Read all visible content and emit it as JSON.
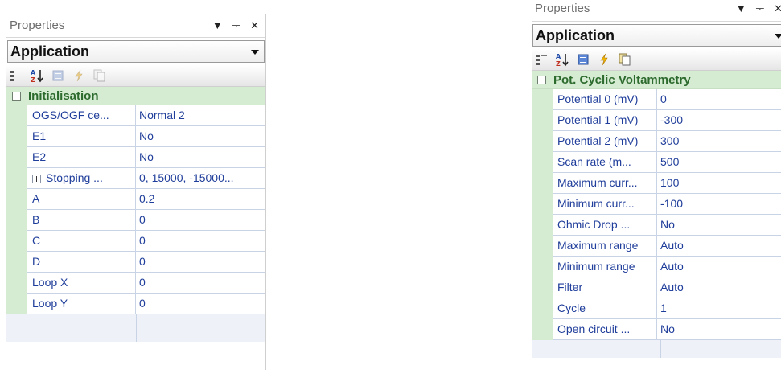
{
  "panels": [
    {
      "title": "Properties",
      "buttons": {
        "dropdown": "▼",
        "pin": "ᅮ",
        "close": "✕"
      },
      "combo_value": "Application",
      "category": "Initialisation",
      "rows": [
        {
          "name": "OGS/OGF ce...",
          "value": "Normal 2"
        },
        {
          "name": "E1",
          "value": "No"
        },
        {
          "name": "E2",
          "value": "No"
        },
        {
          "name": "Stopping ...",
          "value": "0, 15000, -15000..."
        },
        {
          "name": "A",
          "value": "0.2"
        },
        {
          "name": "B",
          "value": "0"
        },
        {
          "name": "C",
          "value": "0"
        },
        {
          "name": "D",
          "value": "0"
        },
        {
          "name": "Loop X",
          "value": "0"
        },
        {
          "name": "Loop Y",
          "value": "0"
        }
      ]
    },
    {
      "title": "Properties",
      "buttons": {
        "dropdown": "▼",
        "pin": "ᅮ",
        "close": "✕"
      },
      "combo_value": "Application",
      "category": "Pot. Cyclic Voltammetry",
      "rows": [
        {
          "name": "Potential 0 (mV)",
          "value": "0"
        },
        {
          "name": "Potential 1 (mV)",
          "value": "-300"
        },
        {
          "name": "Potential 2 (mV)",
          "value": "300"
        },
        {
          "name": "Scan rate (m...",
          "value": "500"
        },
        {
          "name": "Maximum curr...",
          "value": "100"
        },
        {
          "name": "Minimum curr...",
          "value": "-100"
        },
        {
          "name": "Ohmic Drop ...",
          "value": "No"
        },
        {
          "name": "Maximum range",
          "value": "Auto"
        },
        {
          "name": "Minimum range",
          "value": "Auto"
        },
        {
          "name": "Filter",
          "value": "Auto"
        },
        {
          "name": "Cycle",
          "value": "1"
        },
        {
          "name": "Open circuit ...",
          "value": "No"
        }
      ]
    }
  ],
  "icons": [
    "categorized-icon",
    "alphabetical-sort-icon",
    "property-pages-icon",
    "events-icon",
    "copy-icon"
  ],
  "colors": {
    "category_bg": "#d5ecd3",
    "category_text": "#2d6a2d",
    "value_text": "#1f3d9a",
    "grid_line": "#c8d4e6"
  }
}
